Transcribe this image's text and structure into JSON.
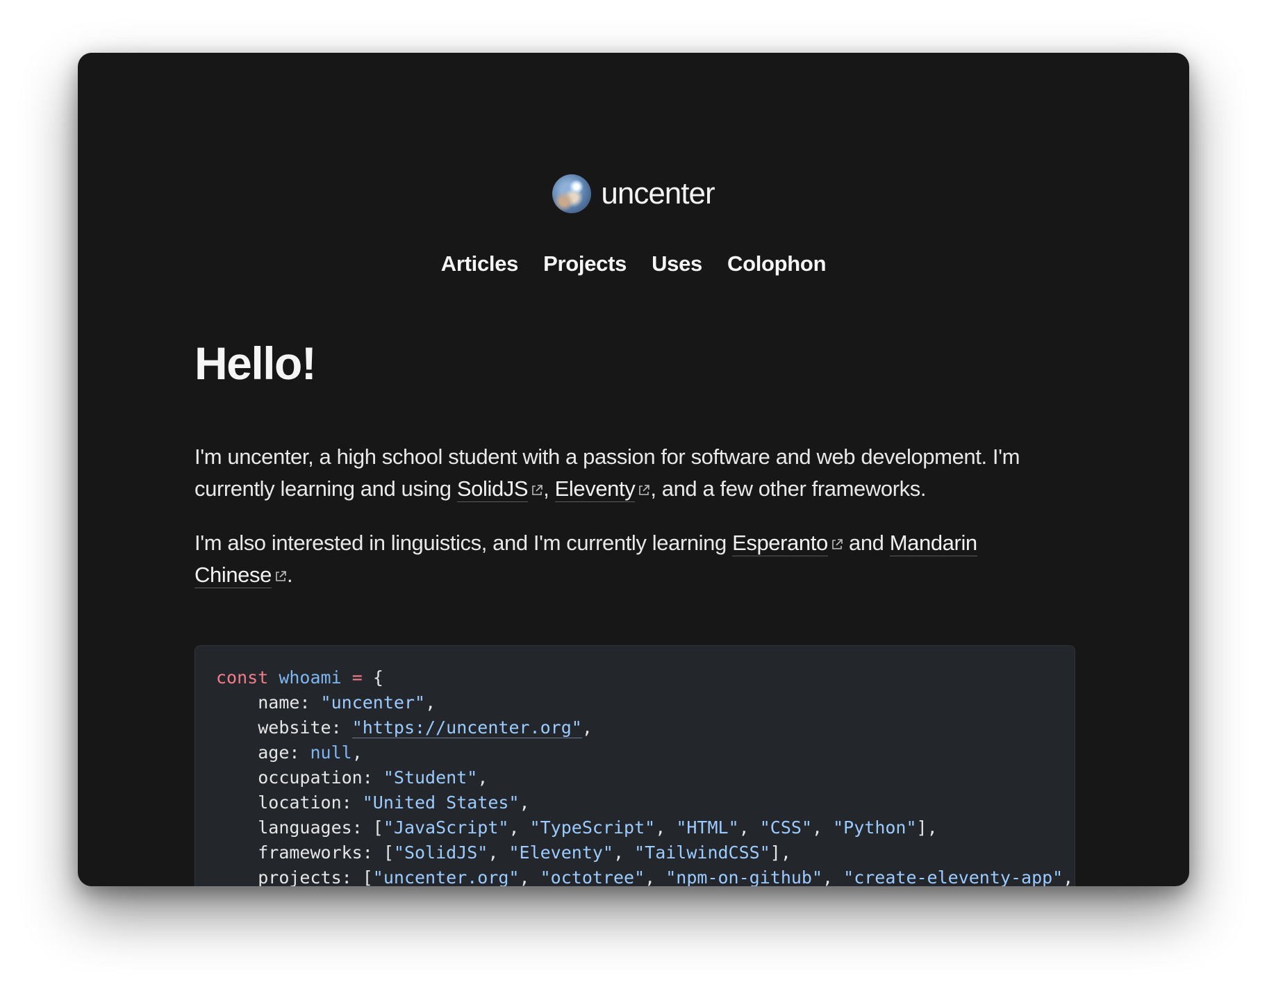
{
  "site": {
    "name": "uncenter"
  },
  "nav": {
    "items": [
      "Articles",
      "Projects",
      "Uses",
      "Colophon"
    ]
  },
  "main": {
    "heading": "Hello!",
    "p1_text_1": "I'm uncenter, a high school student with a passion for software and web development. I'm currently learning and using ",
    "link_solidjs": "SolidJS",
    "p1_comma": ", ",
    "link_eleventy": "Eleventy",
    "p1_text_2": ", and a few other frameworks.",
    "p2_text_1": "I'm also interested in linguistics, and I'm currently learning ",
    "link_esperanto": "Esperanto",
    "p2_and": " and ",
    "link_mandarin_1": "Mandarin",
    "link_mandarin_2": "Chinese",
    "p2_period": "."
  },
  "code": {
    "keyword": "const",
    "varname": "whoami",
    "equals": "=",
    "open_brace": "{",
    "lines": [
      {
        "key": "name",
        "value": "\"uncenter\""
      },
      {
        "key": "website",
        "value": "\"https://uncenter.org\""
      },
      {
        "key": "age",
        "value": "null"
      },
      {
        "key": "occupation",
        "value": "\"Student\""
      },
      {
        "key": "location",
        "value": "\"United States\""
      },
      {
        "key": "languages",
        "values": [
          "\"JavaScript\"",
          "\"TypeScript\"",
          "\"HTML\"",
          "\"CSS\"",
          "\"Python\""
        ]
      },
      {
        "key": "frameworks",
        "values": [
          "\"SolidJS\"",
          "\"Eleventy\"",
          "\"TailwindCSS\""
        ]
      },
      {
        "key": "projects",
        "values": [
          "\"uncenter.org\"",
          "\"octotree\"",
          "\"npm-on-github\"",
          "\"create-eleventy-app\"",
          "\""
        ]
      }
    ]
  },
  "colors": {
    "background": "#171717",
    "code_background": "#23272c",
    "keyword": "#f47c88",
    "string": "#9ccbff"
  },
  "icons": {
    "external_link": "external-link-icon"
  }
}
